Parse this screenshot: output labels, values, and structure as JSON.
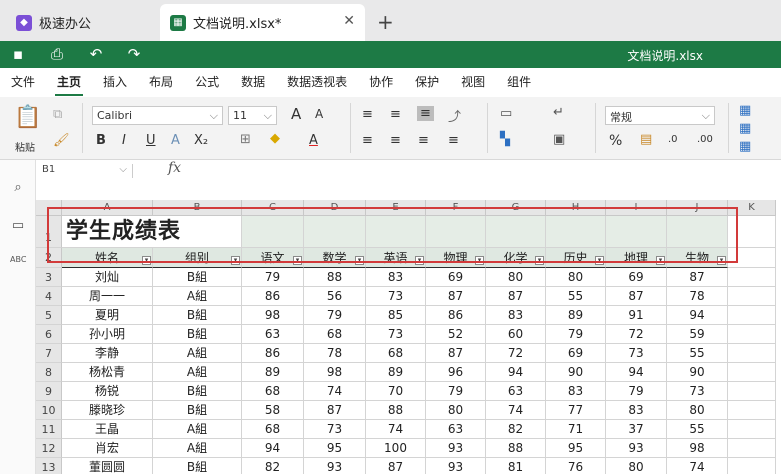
{
  "tabs": {
    "app_label": "极速办公",
    "doc_label": "文档说明.xlsx*",
    "close_glyph": "✕",
    "new_tab_glyph": "+"
  },
  "titlebar": {
    "filename": "文档说明.xlsx"
  },
  "menu": [
    "文件",
    "主页",
    "插入",
    "布局",
    "公式",
    "数据",
    "数据透视表",
    "协作",
    "保护",
    "视图",
    "组件"
  ],
  "ribbon": {
    "paste_label": "粘贴",
    "font_name": "Calibri",
    "font_size": "11",
    "number_format": "常规",
    "bold": "B",
    "italic": "I",
    "underline": "U",
    "strike": "A",
    "subscript": "X₂",
    "grow": "A",
    "shrink": "A",
    "font_color": "A",
    "percent": "%",
    "inc_decimal": ".00",
    "dec_decimal": ".0"
  },
  "formula_bar": {
    "cell_ref": "B1",
    "fx": "fx",
    "value": ""
  },
  "colors": {
    "brand_green": "#1d7a45",
    "highlight_red": "#d23a3a",
    "header_fill": "#dfe8e1"
  },
  "sheet": {
    "columns": [
      "A",
      "B",
      "C",
      "D",
      "E",
      "F",
      "G",
      "H",
      "I",
      "J",
      "K"
    ],
    "title": "学生成绩表",
    "headers": [
      "姓名",
      "组别",
      "语文",
      "数学",
      "英语",
      "物理",
      "化学",
      "历史",
      "地理",
      "生物"
    ],
    "rows": [
      [
        "刘灿",
        "B組",
        "79",
        "88",
        "83",
        "69",
        "80",
        "80",
        "69",
        "87"
      ],
      [
        "周一一",
        "A組",
        "86",
        "56",
        "73",
        "87",
        "87",
        "55",
        "87",
        "78"
      ],
      [
        "夏明",
        "B組",
        "98",
        "79",
        "85",
        "86",
        "83",
        "89",
        "91",
        "94"
      ],
      [
        "孙小明",
        "B組",
        "63",
        "68",
        "73",
        "52",
        "60",
        "79",
        "72",
        "59"
      ],
      [
        "李静",
        "A組",
        "86",
        "78",
        "68",
        "87",
        "72",
        "69",
        "73",
        "55"
      ],
      [
        "杨松青",
        "A組",
        "89",
        "98",
        "89",
        "96",
        "94",
        "90",
        "94",
        "90"
      ],
      [
        "杨锐",
        "B組",
        "68",
        "74",
        "70",
        "79",
        "63",
        "83",
        "79",
        "73"
      ],
      [
        "滕晓珍",
        "B組",
        "58",
        "87",
        "88",
        "80",
        "74",
        "77",
        "83",
        "80"
      ],
      [
        "王晶",
        "A組",
        "68",
        "73",
        "74",
        "63",
        "82",
        "71",
        "37",
        "55"
      ],
      [
        "肖宏",
        "A組",
        "94",
        "95",
        "100",
        "93",
        "88",
        "95",
        "93",
        "98"
      ],
      [
        "董圆圆",
        "B組",
        "82",
        "93",
        "87",
        "93",
        "81",
        "76",
        "80",
        "74"
      ]
    ],
    "row_numbers": [
      "1",
      "2",
      "3",
      "4",
      "5",
      "6",
      "7",
      "8",
      "9",
      "10",
      "11",
      "12",
      "13"
    ]
  }
}
